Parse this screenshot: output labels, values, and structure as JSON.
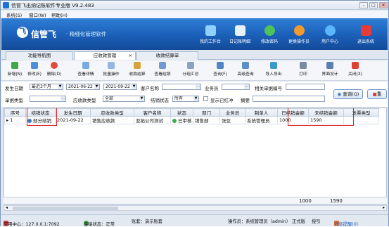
{
  "window": {
    "title": "信管飞出纳记账软件专业版 V9.2.483"
  },
  "menu": [
    "系统(S)",
    "窗口(W)",
    "帮助(H)"
  ],
  "brand": {
    "mark": "飞",
    "name": "信管飞",
    "slogan": "· 精细化管理软件"
  },
  "top_buttons": [
    "我的工作台",
    "日记账明细",
    "修改密码",
    "更换操作员",
    "用户中心",
    "退出系统"
  ],
  "tabs": [
    "功能导航图",
    "应收款管理",
    "收款结算单"
  ],
  "toolbar": [
    "新增(N)",
    "修改(E)",
    "删除(D)",
    "查看详情",
    "批量操作",
    "收款结算",
    "查看结销",
    "分组汇总",
    "查询(F)",
    "高级查询",
    "导入导出",
    "打印",
    "界面设计",
    "关闭(X)"
  ],
  "filters": {
    "date_label": "发生日期",
    "date_range": "最近3个月",
    "date_from": "2021-06-22",
    "date_to": "2021-09-22",
    "customer_label": "客户名称",
    "customer_value": "",
    "sales_label": "业务员",
    "sales_value": "",
    "related_label": "相关单据编号",
    "related_value": "",
    "doc_type_label": "单据类型",
    "doc_type_value": "",
    "receivable_type_label": "应收款类型",
    "receivable_type_value": "全部",
    "settle_status_label": "结销状态",
    "settle_status_value": "所有",
    "show_red_label": "显示已红冲",
    "summary_label": "摘要",
    "summary_value": "",
    "query_button": "查询(Q)",
    "reset_button": "重"
  },
  "table": {
    "columns": [
      "序号",
      "结销状态",
      "发生日期",
      "应收款类型",
      "客户名称",
      "状态",
      "部门",
      "业务员",
      "制单人",
      "已结销金额",
      "未结销金额",
      "发票类型"
    ],
    "rows": [
      {
        "index": "1",
        "settle_status": "部分结销",
        "date": "2021-09-22",
        "type": "销售应收款",
        "customer": "亚拓公司测试",
        "status": "已审核",
        "dept": "销售部",
        "sales": "张亚",
        "maker": "系统管理员",
        "settled": "1000",
        "unsettled": "1590",
        "invoice": ""
      }
    ],
    "totals": {
      "settled": "1000",
      "unsettled": "1590"
    }
  },
  "status_bar": {
    "app_center": "应用中心：127.0.0.1:7092",
    "connection": "连接状态：正常",
    "account": "账套：演示账套",
    "operator": "操作员：系统管理员（admin）",
    "edition": "正式版",
    "register": "授引",
    "messages": "消息提醒(0)"
  },
  "colors": {
    "banner": "#1b5fb8",
    "highlight_box": "#e02323",
    "accent": "#2f7ed6"
  }
}
